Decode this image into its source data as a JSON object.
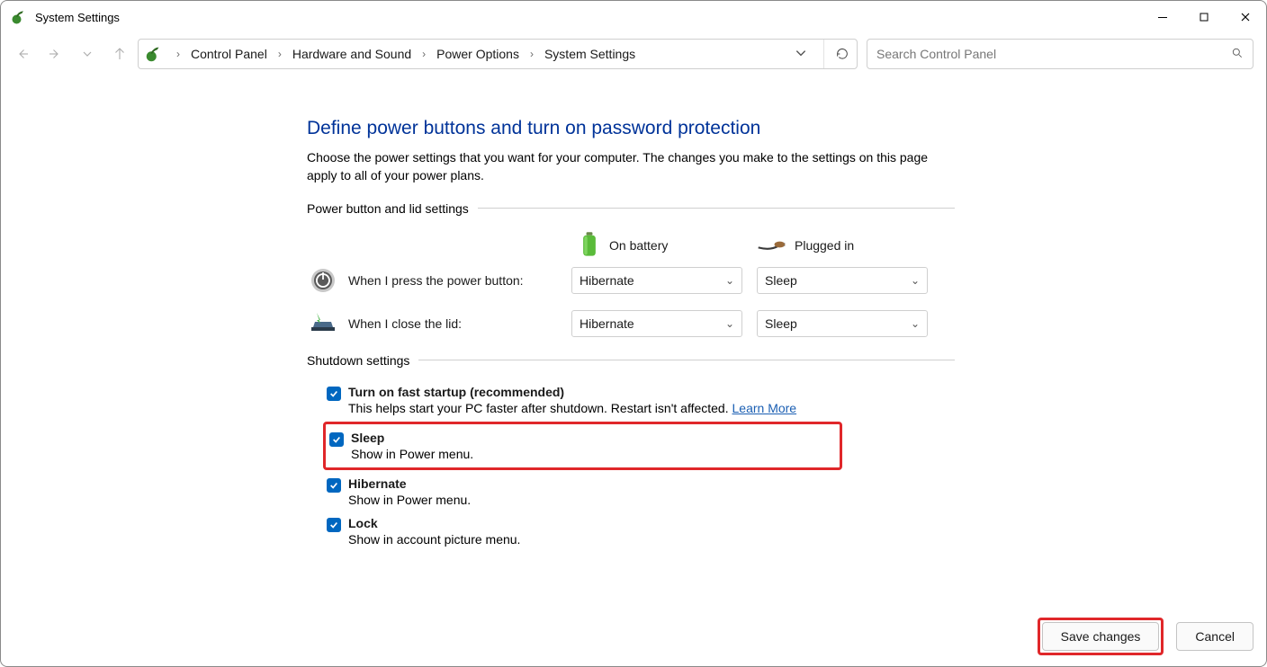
{
  "window": {
    "title": "System Settings"
  },
  "breadcrumb": {
    "items": [
      "Control Panel",
      "Hardware and Sound",
      "Power Options",
      "System Settings"
    ]
  },
  "search": {
    "placeholder": "Search Control Panel"
  },
  "page": {
    "title": "Define power buttons and turn on password protection",
    "description": "Choose the power settings that you want for your computer. The changes you make to the settings on this page apply to all of your power plans."
  },
  "sections": {
    "power_button": {
      "label": "Power button and lid settings"
    },
    "shutdown": {
      "label": "Shutdown settings"
    }
  },
  "columns": {
    "battery": "On battery",
    "plugged": "Plugged in"
  },
  "rows": {
    "power_button": {
      "label": "When I press the power button:",
      "battery": "Hibernate",
      "plugged": "Sleep"
    },
    "close_lid": {
      "label": "When I close the lid:",
      "battery": "Hibernate",
      "plugged": "Sleep"
    }
  },
  "shutdown_settings": {
    "fast_startup": {
      "title": "Turn on fast startup (recommended)",
      "desc": "This helps start your PC faster after shutdown. Restart isn't affected. ",
      "link": "Learn More"
    },
    "sleep": {
      "title": "Sleep",
      "desc": "Show in Power menu."
    },
    "hibernate": {
      "title": "Hibernate",
      "desc": "Show in Power menu."
    },
    "lock": {
      "title": "Lock",
      "desc": "Show in account picture menu."
    }
  },
  "footer": {
    "save": "Save changes",
    "cancel": "Cancel"
  }
}
